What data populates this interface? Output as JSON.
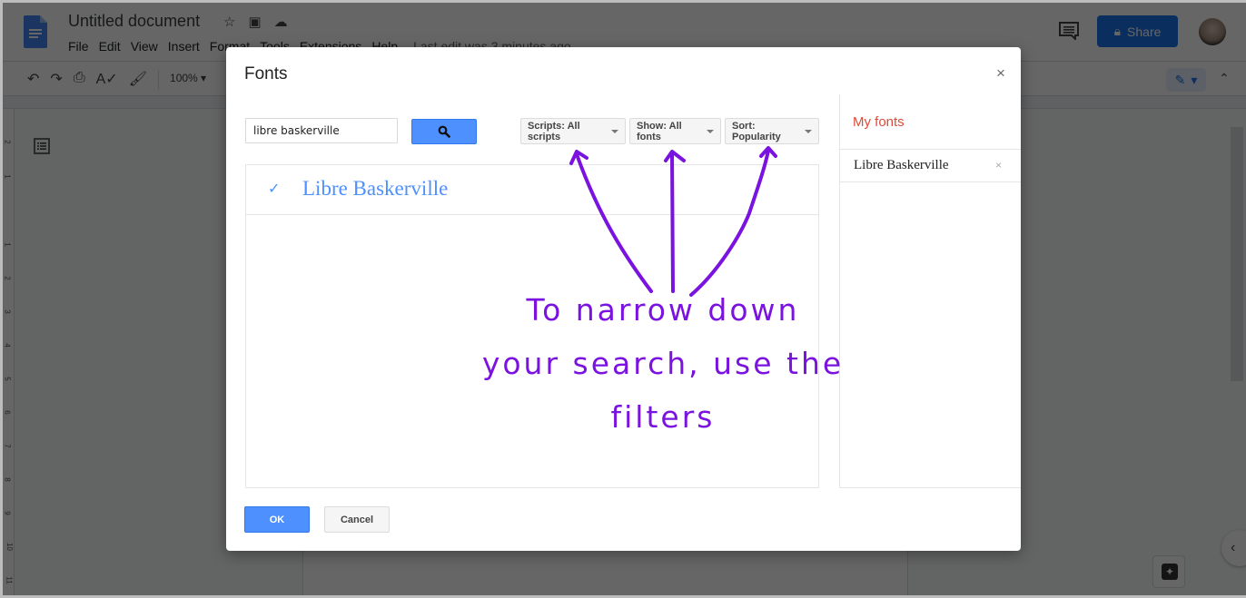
{
  "app": {
    "doc_title": "Untitled document",
    "menu": [
      "File",
      "Edit",
      "View",
      "Insert",
      "Format",
      "Tools",
      "Extensions",
      "Help"
    ],
    "last_edit": "Last edit was 3 minutes ago",
    "share_label": "Share",
    "zoom_level": "100%",
    "title_icons": [
      "star-icon",
      "move-to-folder-icon",
      "cloud-saved-icon"
    ],
    "toolbar_icons": [
      "undo-icon",
      "redo-icon",
      "print-icon",
      "spellcheck-icon",
      "paint-format-icon"
    ],
    "ruler_numbers": [
      "2",
      "1",
      "1",
      "2",
      "3",
      "4",
      "5",
      "6",
      "7",
      "8",
      "9",
      "10",
      "11"
    ]
  },
  "dialog": {
    "title": "Fonts",
    "close_glyph": "×",
    "search": {
      "value": "libre baskerville",
      "placeholder": ""
    },
    "filters": {
      "scripts": "Scripts: All scripts",
      "show": "Show: All fonts",
      "sort": "Sort: Popularity"
    },
    "results": [
      {
        "name": "Libre Baskerville",
        "selected": true,
        "check_glyph": "✓"
      }
    ],
    "my_fonts": {
      "title": "My fonts",
      "items": [
        {
          "name": "Libre Baskerville",
          "remove_glyph": "×"
        }
      ]
    },
    "ok_label": "OK",
    "cancel_label": "Cancel"
  },
  "annotation": {
    "lines": [
      "To narrow down",
      "your search, use the",
      "filters"
    ],
    "color": "#7a12e0"
  },
  "colors": {
    "accent_blue": "#4d90fe",
    "share_blue": "#1a73e8",
    "my_fonts_red": "#dd4b39"
  }
}
